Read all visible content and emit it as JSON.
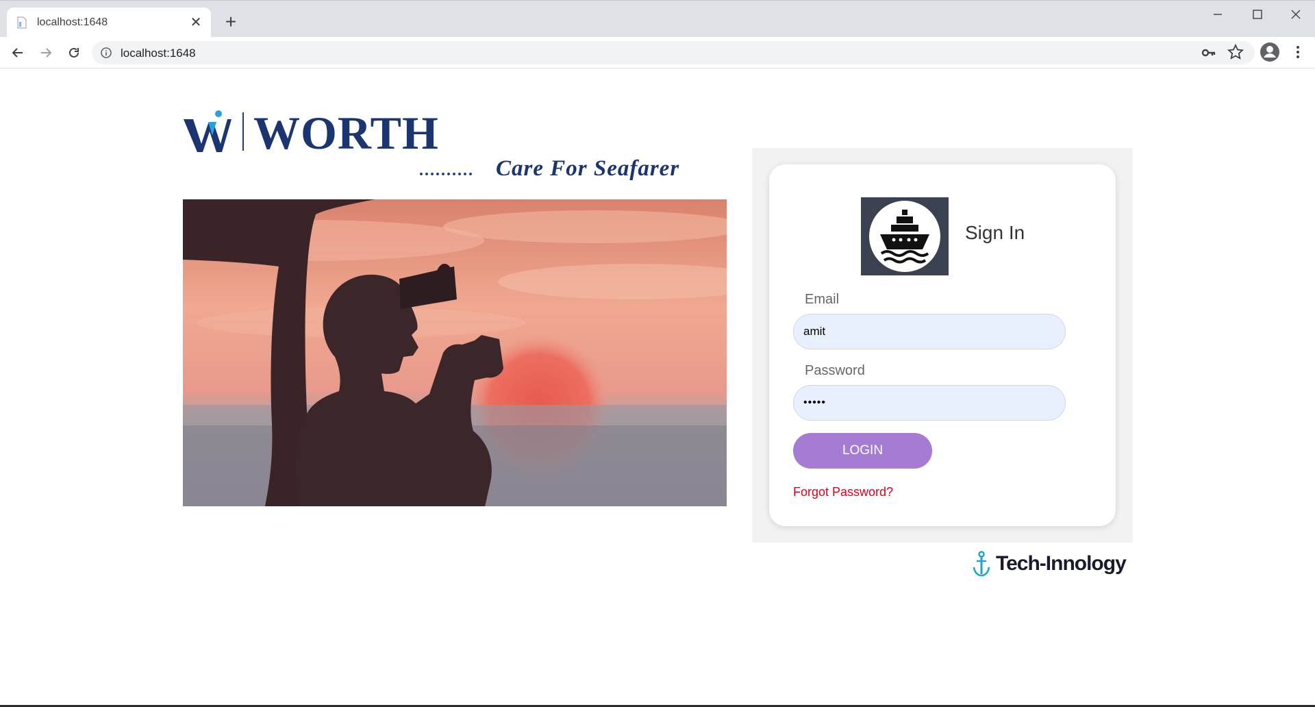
{
  "browser": {
    "tab_title": "localhost:1648",
    "url": "localhost:1648"
  },
  "logo": {
    "brand_name": "WORTH",
    "dots": "..........",
    "tagline": "Care For Seafarer"
  },
  "login": {
    "title": "Sign In",
    "email_label": "Email",
    "email_value": "amit",
    "password_label": "Password",
    "password_value": "•••••",
    "login_button": "LOGIN",
    "forgot_link": "Forgot Password?"
  },
  "footer": {
    "brand": "Tech-Innology"
  },
  "colors": {
    "login_button": "#a67bd4",
    "forgot_link": "#e0001a",
    "input_bg": "#e8f0fe",
    "logo_navy": "#1a3570"
  }
}
